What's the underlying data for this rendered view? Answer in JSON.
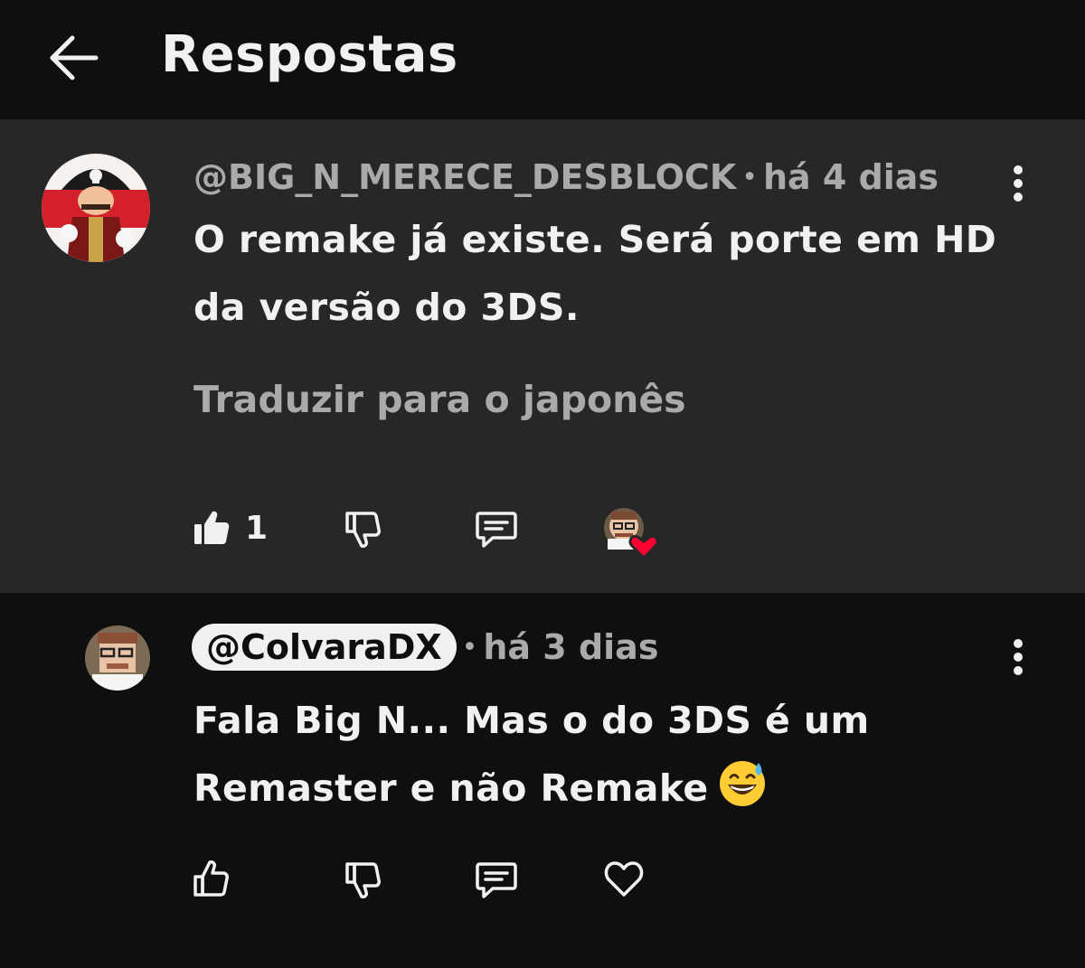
{
  "header": {
    "title": "Respostas"
  },
  "parent_comment": {
    "handle": "@BIG_N_MERECE_DESBLOCK",
    "separator": "•",
    "time": "há 4 dias",
    "text_line1": "O remake já existe. Será porte em HD",
    "text_line2": "da versão do 3DS.",
    "translate": "Traduzir para o japonês",
    "like_count": "1",
    "liked": true,
    "creator_heart": true
  },
  "reply_comment": {
    "handle": "@ColvaraDX",
    "separator": "•",
    "time": "há 3 dias",
    "text_line1": "Fala Big N... Mas o do 3DS é um",
    "text_line2": "Remaster e não Remake",
    "emoji": "grinning-face-with-sweat",
    "liked": false
  },
  "colors": {
    "background": "#0f0f0f",
    "highlight_background": "#272727",
    "text": "#f1f1f1",
    "secondary_text": "#aaaaaa",
    "heart_red": "#ff0033"
  }
}
